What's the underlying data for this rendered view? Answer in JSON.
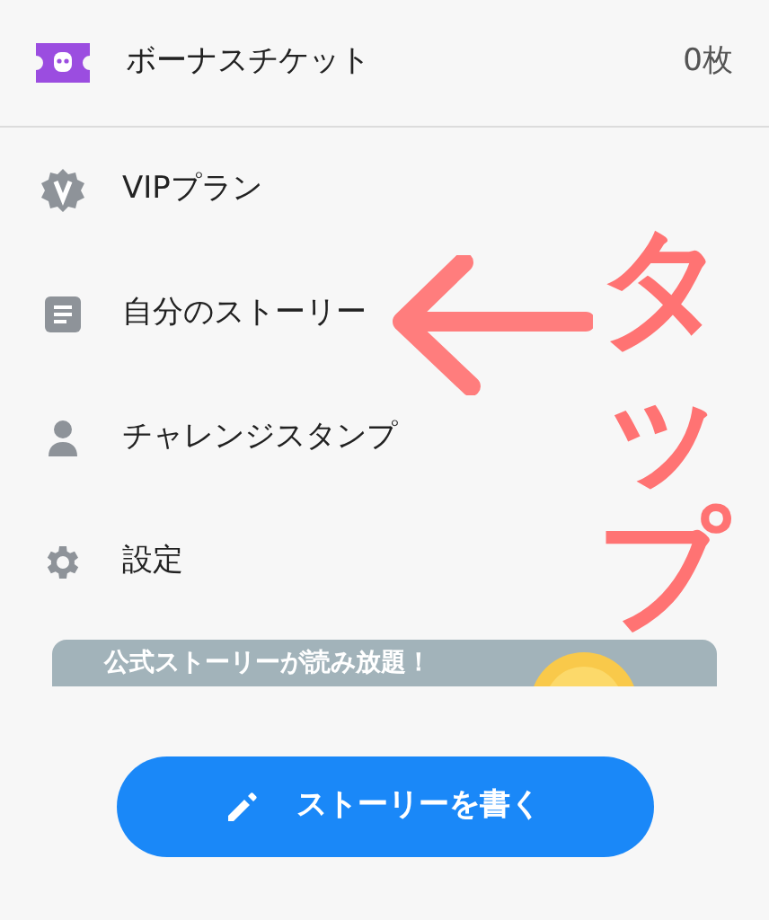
{
  "bonus_ticket": {
    "label": "ボーナスチケット",
    "count": "0枚"
  },
  "menu_items": [
    {
      "label": "VIPプラン"
    },
    {
      "label": "自分のストーリー"
    },
    {
      "label": "チャレンジスタンプ"
    },
    {
      "label": "設定"
    }
  ],
  "banner": {
    "text": "公式ストーリーが読み放題！"
  },
  "write_button": {
    "label": "ストーリーを書く"
  },
  "annotation": {
    "text": "タップ"
  }
}
